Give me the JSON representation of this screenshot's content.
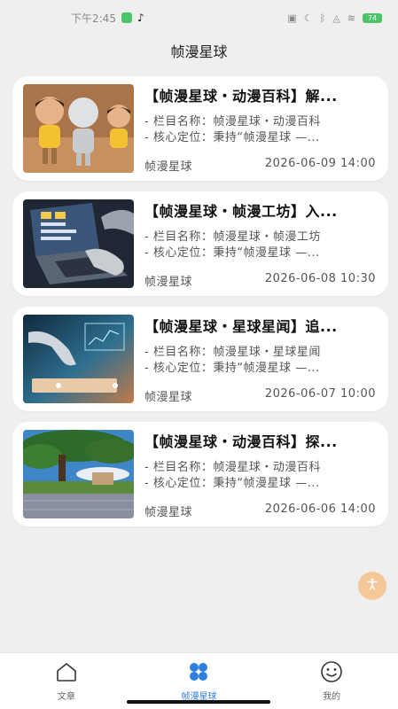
{
  "status_bar": {
    "time": "下午2:45",
    "battery": "74"
  },
  "header": {
    "title": "帧漫星球"
  },
  "articles": [
    {
      "title": "【帧漫星球・动漫百科】解...",
      "line1": "- 栏目名称：帧漫星球・动漫百科",
      "line2": "- 核心定位：秉持“帧漫星球 —...",
      "source": "帧漫星球",
      "date": "2026-06-09 14:00",
      "image": "cartoon-kids-image"
    },
    {
      "title": "【帧漫星球・帧漫工坊】入...",
      "line1": "- 栏目名称：帧漫星球・帧漫工坊",
      "line2": "- 核心定位：秉持“帧漫星球 —...",
      "source": "帧漫星球",
      "date": "2026-06-08 10:30",
      "image": "laptop-hand-image"
    },
    {
      "title": "【帧漫星球・星球星闻】追...",
      "line1": "- 栏目名称：帧漫星球・星球星闻",
      "line2": "- 核心定位：秉持“帧漫星球 —...",
      "source": "帧漫星球",
      "date": "2026-06-07 10:00",
      "image": "robot-hand-image"
    },
    {
      "title": "【帧漫星球・动漫百科】探...",
      "line1": "- 栏目名称：帧漫星球・动漫百科",
      "line2": "- 核心定位：秉持“帧漫星球 —...",
      "source": "帧漫星球",
      "date": "2026-06-06 14:00",
      "image": "tree-landscape-image"
    }
  ],
  "tabbar": {
    "tabs": [
      {
        "label": "文章",
        "icon": "house-icon"
      },
      {
        "label": "帧漫星球",
        "icon": "clover-icon"
      },
      {
        "label": "我的",
        "icon": "smiley-icon"
      }
    ],
    "active_color": "#2f7fe0"
  },
  "float_button": {
    "icon": "accessibility-icon",
    "color": "#f5c89a"
  }
}
